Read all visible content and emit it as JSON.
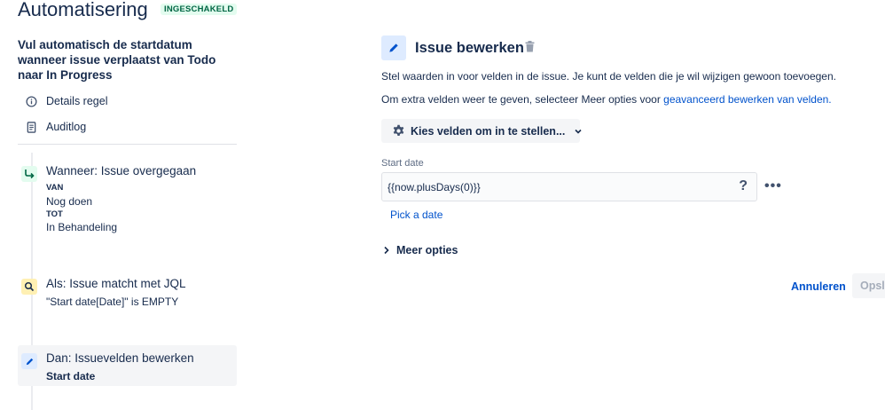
{
  "header": {
    "title": "Automatisering",
    "status_badge": "INGESCHAKELD"
  },
  "sidebar": {
    "rule_title": "Vul automatisch de startdatum wanneer issue verplaatst van Todo naar In Progress",
    "nav": [
      {
        "label": "Details regel",
        "icon": "info-icon"
      },
      {
        "label": "Auditlog",
        "icon": "document-icon"
      }
    ],
    "steps": [
      {
        "title": "Wanneer: Issue overgegaan",
        "icon": "transition-icon",
        "from_label": "VAN",
        "from_value": "Nog doen",
        "to_label": "TOT",
        "to_value": "In Behandeling"
      },
      {
        "title": "Als: Issue matcht met JQL",
        "icon": "search-icon",
        "detail": "\"Start date[Date]\" is EMPTY"
      },
      {
        "title": "Dan: Issuevelden bewerken",
        "icon": "pencil-icon",
        "detail": "Start date"
      }
    ]
  },
  "editor": {
    "title": "Issue bewerken",
    "description": "Stel waarden in voor velden in de issue. Je kunt de velden die je wil wijzigen gewoon toevoegen.",
    "more_prefix": "Om extra velden weer te geven, selecteer Meer opties voor ",
    "more_link": "geavanceerd bewerken van velden.",
    "choose_fields_label": "Kies velden om in te stellen...",
    "field_label": "Start date",
    "field_value": "{{now.plusDays(0)}}",
    "help_glyph": "?",
    "more_glyph": "•••",
    "pick_date": "Pick a date",
    "more_options": "Meer opties",
    "cancel": "Annuleren",
    "save": "Opslaan"
  },
  "colors": {
    "accent": "#0052cc",
    "text": "#172b4d",
    "badge_bg": "#e3fcef",
    "badge_text": "#006644",
    "trigger_icon_bg": "#e3fcef",
    "condition_icon_bg": "#fff0b3",
    "action_icon_bg": "#deebff"
  }
}
